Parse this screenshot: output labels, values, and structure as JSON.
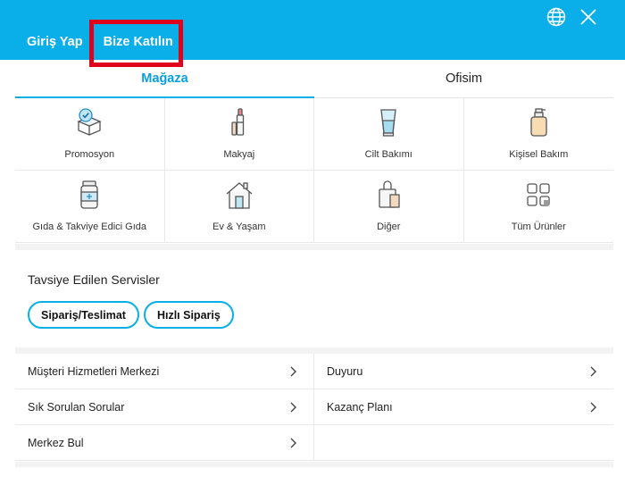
{
  "header": {
    "login_label": "Giriş Yap",
    "join_label": "Bize Katılın",
    "icons": [
      "globe-icon",
      "close-icon"
    ],
    "background_color": "#0aaee8",
    "highlight_color": "#e0001b"
  },
  "tabs": [
    {
      "label": "Mağaza",
      "active": true
    },
    {
      "label": "Ofisim",
      "active": false
    }
  ],
  "categories": [
    {
      "label": "Promosyon",
      "icon": "promotion-box-icon"
    },
    {
      "label": "Makyaj",
      "icon": "makeup-icon"
    },
    {
      "label": "Cilt Bakımı",
      "icon": "skincare-icon"
    },
    {
      "label": "Kişisel Bakım",
      "icon": "personal-care-icon"
    },
    {
      "label": "Gıda & Takviye Edici Gıda",
      "icon": "supplement-icon"
    },
    {
      "label": "Ev & Yaşam",
      "icon": "home-icon"
    },
    {
      "label": "Diğer",
      "icon": "other-bag-icon"
    },
    {
      "label": "Tüm Ürünler",
      "icon": "all-products-grid-icon"
    }
  ],
  "services": {
    "title": "Tavsiye Edilen Servisler",
    "buttons": [
      "Sipariş/Teslimat",
      "Hızlı Sipariş"
    ]
  },
  "links": [
    {
      "label": "Müşteri Hizmetleri Merkezi"
    },
    {
      "label": "Duyuru"
    },
    {
      "label": "Sık Sorulan Sorular"
    },
    {
      "label": "Kazanç Planı"
    },
    {
      "label": "Merkez Bul"
    }
  ]
}
